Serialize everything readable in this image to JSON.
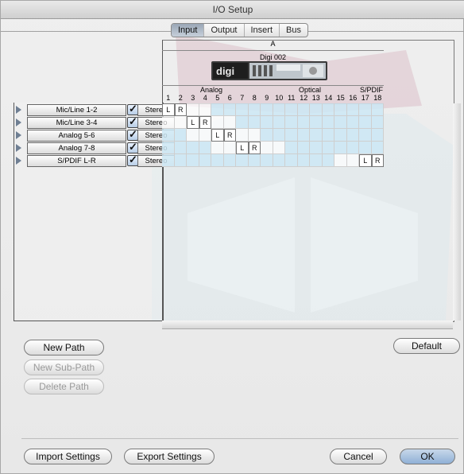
{
  "window": {
    "title": "I/O Setup"
  },
  "tabs": [
    {
      "label": "Input",
      "selected": true
    },
    {
      "label": "Output",
      "selected": false
    },
    {
      "label": "Insert",
      "selected": false
    },
    {
      "label": "Bus",
      "selected": false
    }
  ],
  "grid_header": {
    "section": "A",
    "device": "Digi 002",
    "device_logo": "digi",
    "groups": [
      "Analog",
      "Optical",
      "S/PDIF"
    ],
    "channels": [
      "1",
      "2",
      "3",
      "4",
      "5",
      "6",
      "7",
      "8",
      "9",
      "10",
      "11",
      "12",
      "13",
      "14",
      "15",
      "16",
      "17",
      "18"
    ]
  },
  "paths": [
    {
      "name": "Mic/Line 1-2",
      "checked": true,
      "format": "Stereo",
      "L": 1,
      "R": 2
    },
    {
      "name": "Mic/Line 3-4",
      "checked": true,
      "format": "Stereo",
      "L": 3,
      "R": 4
    },
    {
      "name": "Analog 5-6",
      "checked": true,
      "format": "Stereo",
      "L": 5,
      "R": 6
    },
    {
      "name": "Analog 7-8",
      "checked": true,
      "format": "Stereo",
      "L": 7,
      "R": 8
    },
    {
      "name": "S/PDIF L-R",
      "checked": true,
      "format": "Stereo",
      "L": 17,
      "R": 18
    }
  ],
  "assign_labels": {
    "left": "L",
    "right": "R"
  },
  "buttons": {
    "new_path": "New Path",
    "new_sub_path": "New Sub-Path",
    "delete_path": "Delete Path",
    "default": "Default",
    "import_settings": "Import Settings",
    "export_settings": "Export Settings",
    "cancel": "Cancel",
    "ok": "OK"
  },
  "colors": {
    "selected_tab": "#9aa7b6",
    "grid_blue": "#cde8f4",
    "ok_button": "#8fb0d6"
  }
}
